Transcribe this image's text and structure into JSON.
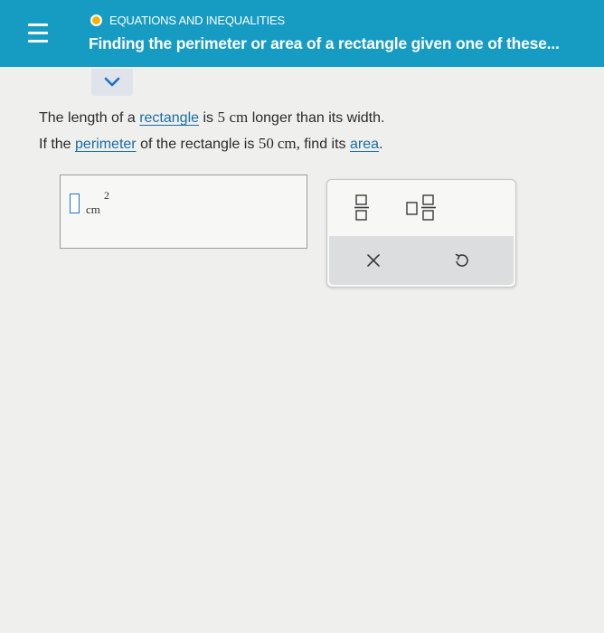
{
  "header": {
    "topic": "EQUATIONS AND INEQUALITIES",
    "title": "Finding the perimeter or area of a rectangle given one of these...",
    "topic_dot_color": "#f4b400",
    "bar_color": "#169bc2"
  },
  "question": {
    "line1": {
      "pre": "The length of a",
      "link": "rectangle",
      "mid": "is",
      "value": "5",
      "unit": "cm",
      "post": "longer than its width."
    },
    "line2": {
      "pre": "If the",
      "link1": "perimeter",
      "mid": "of the rectangle is",
      "value": "50",
      "unit": "cm,",
      "mid2": "find its",
      "link2": "area",
      "post": "."
    }
  },
  "answer": {
    "value": "",
    "unit": "cm",
    "exponent": "2"
  },
  "toolbox": {
    "top_icons": [
      "fraction-icon",
      "mixed-number-icon"
    ],
    "bottom_icons": [
      "clear-x-icon",
      "undo-icon"
    ]
  }
}
